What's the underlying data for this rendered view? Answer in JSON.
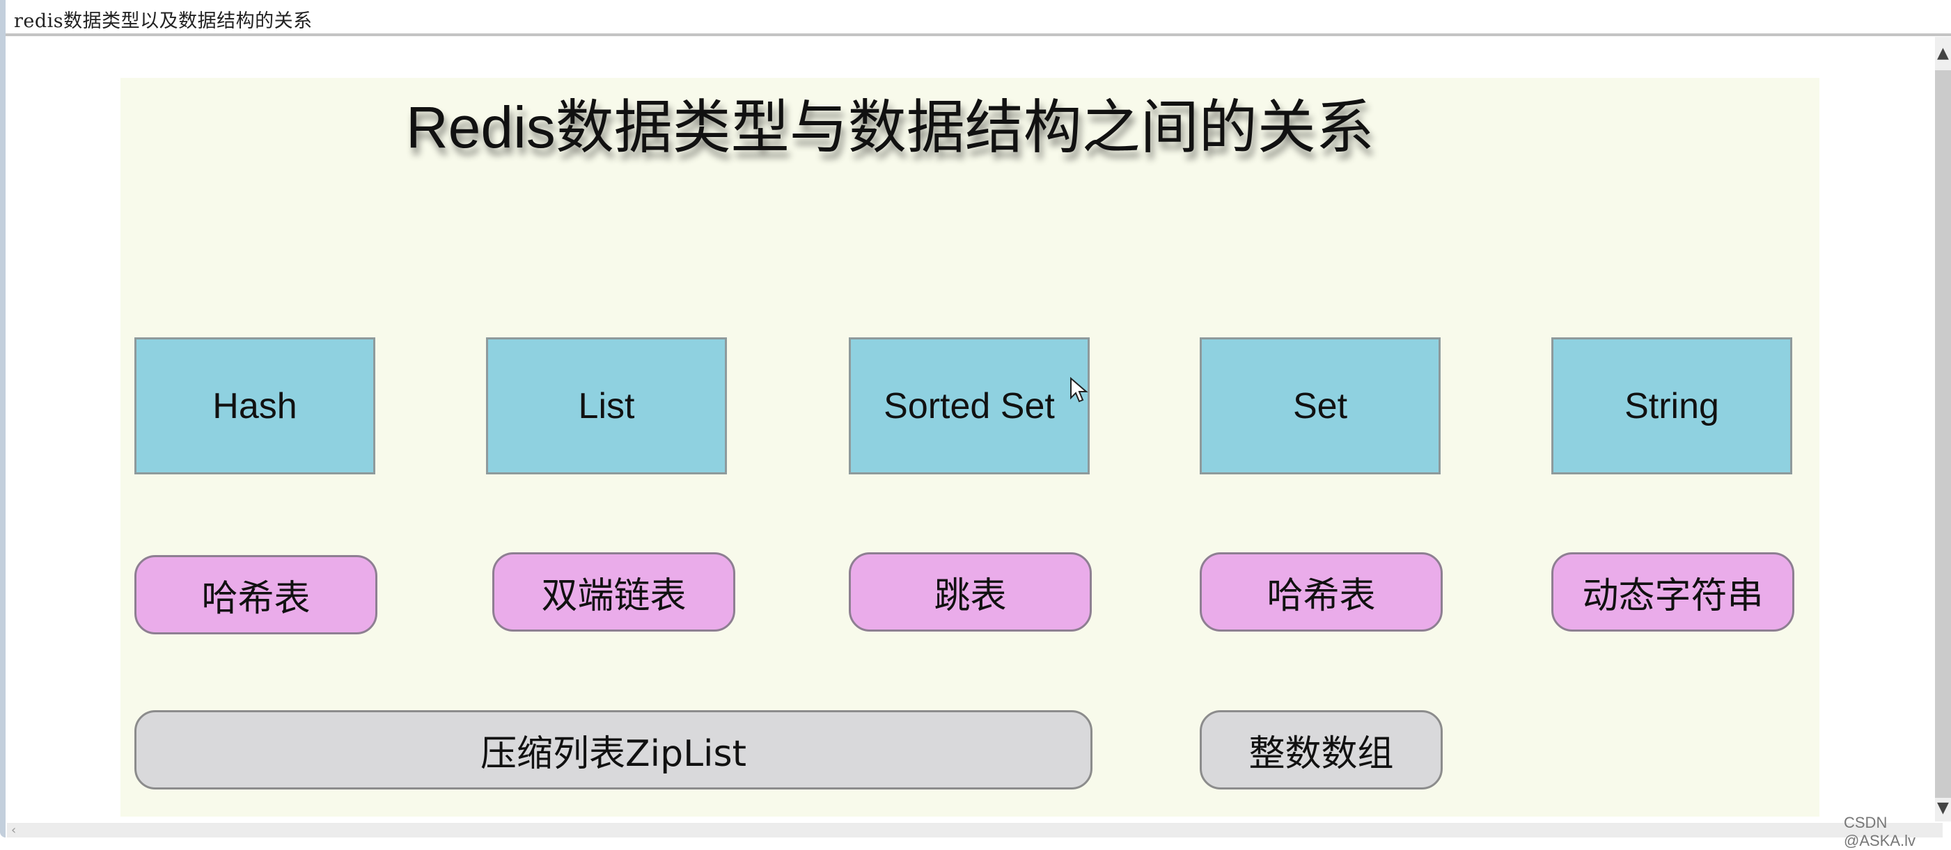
{
  "window": {
    "title": "redis数据类型以及数据结构的关系"
  },
  "slide": {
    "title": "Redis数据类型与数据结构之间的关系",
    "data_types": [
      {
        "label": "Hash"
      },
      {
        "label": "List"
      },
      {
        "label": "Sorted Set"
      },
      {
        "label": "Set"
      },
      {
        "label": "String"
      }
    ],
    "structures": [
      {
        "label": "哈希表"
      },
      {
        "label": "双端链表"
      },
      {
        "label": "跳表"
      },
      {
        "label": "哈希表"
      },
      {
        "label": "动态字符串"
      }
    ],
    "shared_structures": [
      {
        "label": "压缩列表ZipList"
      },
      {
        "label": "整数数组"
      }
    ],
    "colors": {
      "background": "#f8faeb",
      "data_type_fill": "#8fd1e0",
      "structure_fill": "#eaacea",
      "shared_fill": "#d9d9db"
    }
  },
  "scrollbar": {
    "up_icon": "▲",
    "down_icon": "▼",
    "left_icon": "‹"
  },
  "watermark": "CSDN @ASKA.lv"
}
